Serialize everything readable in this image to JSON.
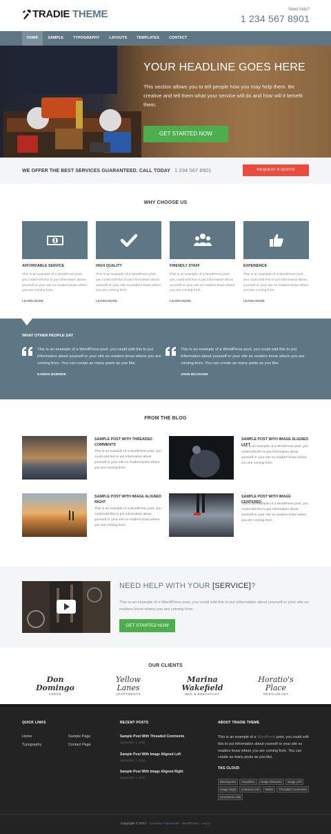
{
  "header": {
    "logo_word1": "TRADIE",
    "logo_word2": "THEME",
    "need_help": "Need help?",
    "phone": "1 234 567 8901"
  },
  "nav": {
    "items": [
      {
        "label": "HOME"
      },
      {
        "label": "SAMPLE"
      },
      {
        "label": "TYPOGRAPHY"
      },
      {
        "label": "LAYOUTS"
      },
      {
        "label": "TEMPLATES"
      },
      {
        "label": "CONTACT"
      }
    ]
  },
  "hero": {
    "title": "YOUR HEADLINE GOES HERE",
    "text": "This section allows you to tell people how you may help them. Be creative and tell them what your service will do and how will it benefit them.",
    "button": "GET STARTED NOW"
  },
  "services_bar": {
    "text": "WE OFFER THE BEST SERVICES GUARANTEED. CALL TODAY",
    "phone": "1 234 567 8901",
    "button": "REQUEST A QUOTE"
  },
  "why": {
    "title": "WHY CHOOSE US",
    "features": [
      {
        "title": "AFFORDABLE SERVICE",
        "icon": "money-icon",
        "desc": "This is an example of a WordPress post, you could edit this to put information about yourself or your site so readers know where you are coming from.",
        "link": "LEARN MORE"
      },
      {
        "title": "HIGH QUALITY",
        "icon": "checkmark-icon",
        "desc": "This is an example of a WordPress post, you could edit this to put information about yourself or your site so readers know where you are coming from.",
        "link": "LEARN MORE"
      },
      {
        "title": "FRIENDLY STAFF",
        "icon": "group-icon",
        "desc": "This is an example of a WordPress post, you could edit this to put information about yourself or your site so readers know where you are coming from.",
        "link": "LEARN MORE"
      },
      {
        "title": "EXPERIENCE",
        "icon": "thumbs-up-icon",
        "desc": "This is an example of a WordPress post, you could edit this to put information about yourself or your site so readers know where you are coming from.",
        "link": "LEARN MORE"
      }
    ]
  },
  "testimonials": {
    "title": "WHAT OTHER PEOPLE SAY",
    "items": [
      {
        "text": "This is an example of a WordPress post, you could edit this to put information about yourself or your site so readers know where you are coming from. You can create as many posts as you like.",
        "author": "DAMON MCBRIDE"
      },
      {
        "text": "This is an example of a WordPress post, you could edit this to put information about yourself or your site so readers know where you are coming from. You can create as many posts as you like.",
        "author": "JOHN MCADAMS"
      }
    ]
  },
  "blog": {
    "title": "FROM THE BLOG",
    "posts": [
      {
        "title": "SAMPLE POST WITH THREADED COMMENTS",
        "desc": "This is an example of a WordPress post, you could edit this to put information about yourself or your site so readers know where you are coming from."
      },
      {
        "title": "SAMPLE POST WITH IMAGE ALIGNED LEFT",
        "desc": "This is an example of a WordPress post, you could edit this to put information about yourself or your site so readers know where you are coming from."
      },
      {
        "title": "SAMPLE POST WITH IMAGE ALIGNED RIGHT",
        "desc": "This is an example of a WordPress post, you could edit this to put information about yourself or your site so readers know where you are coming from."
      },
      {
        "title": "SAMPLE POST WITH IMAGE CENTERED",
        "desc": "This is an example of a WordPress post, you could edit this to put information about yourself or your site so readers know where you are coming from."
      }
    ]
  },
  "cta": {
    "heading_pre": "NEED HELP WITH YOUR",
    "heading_service": "[SERVICE]",
    "heading_post": "?",
    "text": "This is an example of a WordPress post, you could edit this to put information about yourself or your site so readers know where you are coming from.",
    "button": "GET STARTED NOW"
  },
  "clients": {
    "title": "OUR CLIENTS",
    "items": [
      {
        "name": "Don Domingo",
        "sub": "LODGE"
      },
      {
        "name": "Yellow Lanes",
        "sub": "APARTMENTS"
      },
      {
        "name": "Marina Wakefield",
        "sub": "BED & BREAKFAST"
      },
      {
        "name": "Horatio's Place",
        "sub": "RESTAURANT"
      }
    ]
  },
  "footer": {
    "quick_links_title": "QUICK LINKS",
    "quick_links": [
      "Home",
      "Sample Page",
      "Typography",
      "Contact Page"
    ],
    "recent_title": "RECENT POSTS",
    "recent": [
      {
        "title": "Sample Post With Threaded Comments",
        "date": "September 1, 2015"
      },
      {
        "title": "Sample Post With Image Aligned Left",
        "date": "September 1, 2015"
      },
      {
        "title": "Sample Post With Image Aligned Right",
        "date": "September 1, 2015"
      }
    ],
    "about_title": "ABOUT TRADIE THEME",
    "about_pre": "This is an example of a",
    "about_link": "WordPress",
    "about_post": "post, you could edit this to put information about yourself or your site so readers know where you are coming from. You can create as many posts as you like.",
    "tag_title": "TAG CLOUD",
    "tags": [
      "Blockquotes",
      "Headlines",
      "Image Elements",
      "Image Left",
      "Image Right",
      "Ordered Lists",
      "Tables",
      "Threaded Comments",
      "Unordered Lists"
    ],
    "copyright_pre": "Copyright © 2017 ·",
    "copyright_link1": "Genesis Framework",
    "copyright_sep1": "·",
    "copyright_link2": "WordPress",
    "copyright_sep2": "·",
    "copyright_link3": "Log in"
  },
  "colors": {
    "accent": "#5e7785",
    "green": "#4cae4c",
    "red": "#e74c3c",
    "footer_bg": "#232323"
  }
}
